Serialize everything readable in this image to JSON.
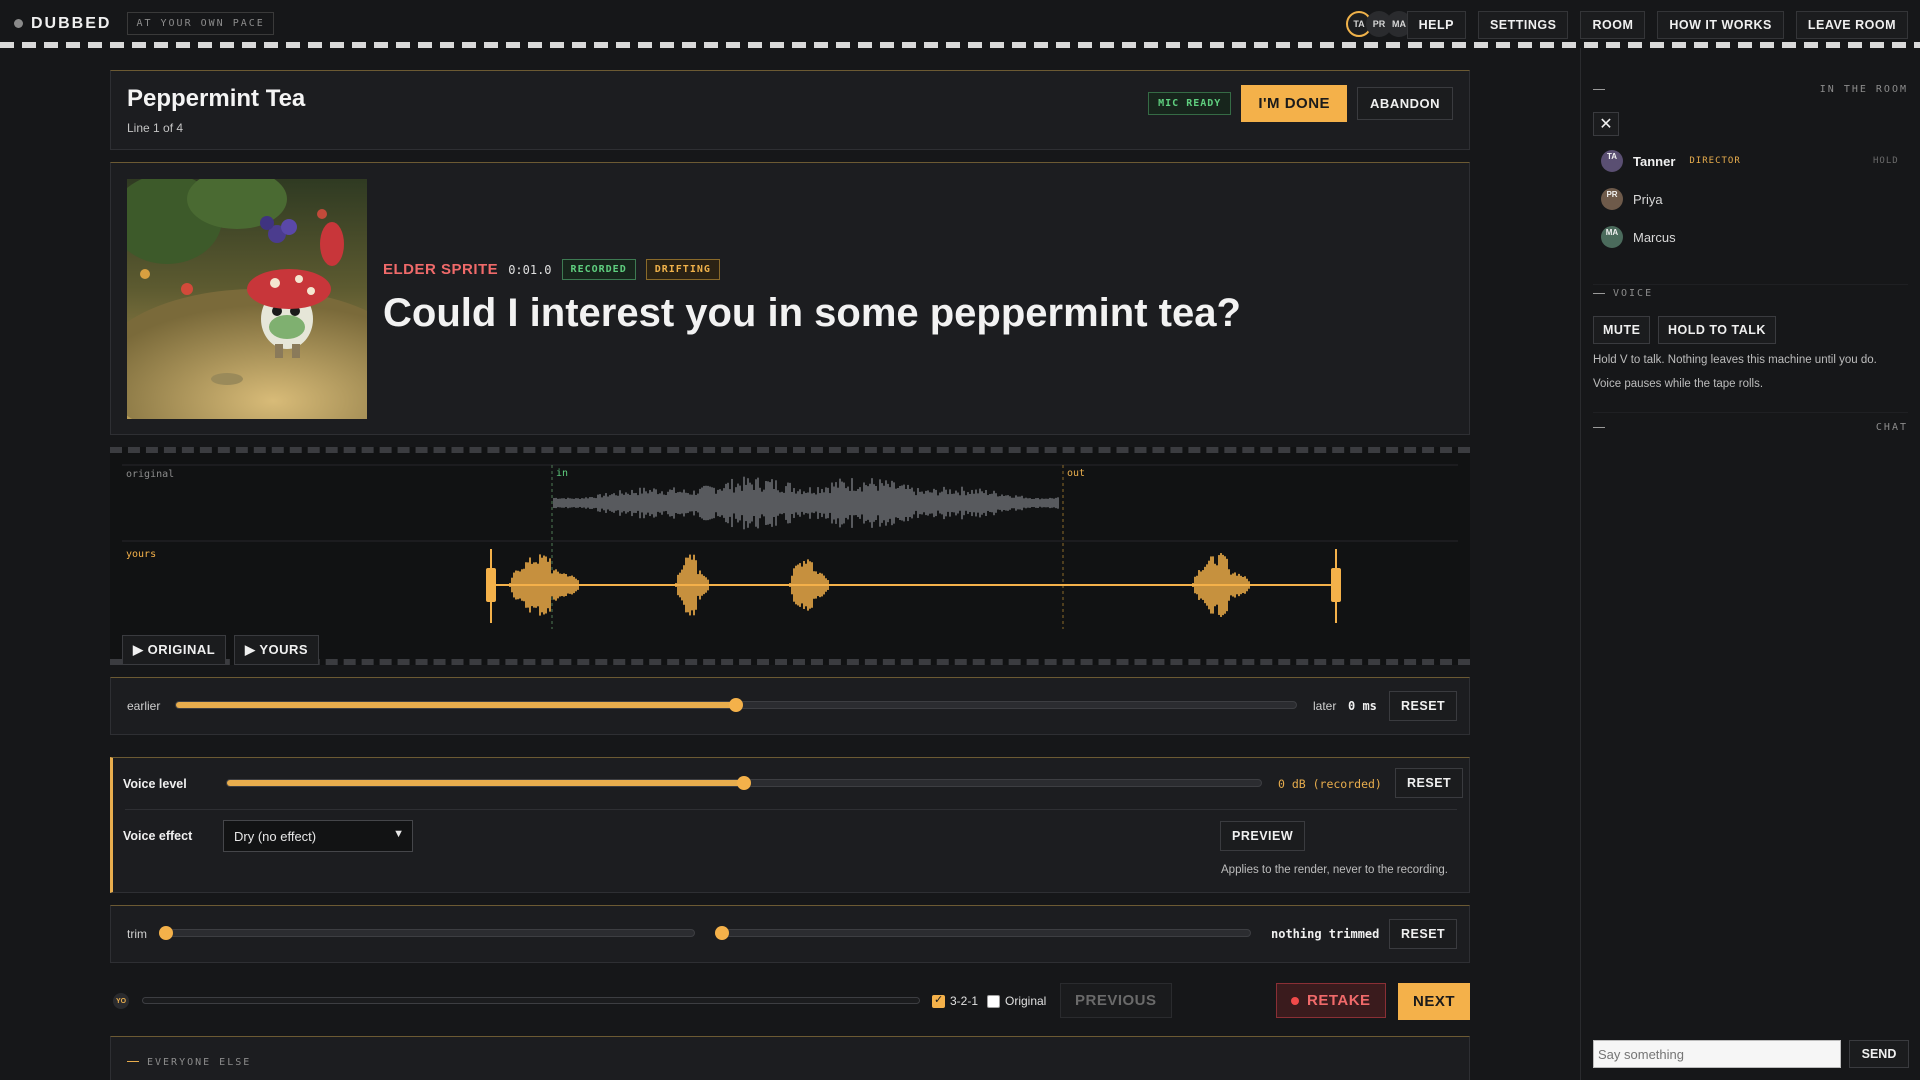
{
  "topbar": {
    "brand": "DUBBED",
    "mode_badge": "AT YOUR OWN PACE",
    "presence": [
      "TA",
      "PR",
      "MA"
    ],
    "nav": [
      "HELP",
      "SETTINGS",
      "ROOM",
      "HOW IT WORKS",
      "LEAVE ROOM"
    ]
  },
  "header": {
    "title": "Peppermint Tea",
    "subtitle": "Line 1 of 4",
    "mic_status": "MIC READY",
    "done_label": "I'M DONE",
    "abandon_label": "ABANDON"
  },
  "line": {
    "character": "ELDER SPRITE",
    "timecode": "0:01.0",
    "tags": [
      "RECORDED",
      "DRIFTING"
    ],
    "text": "Could I interest you in some peppermint tea?"
  },
  "waveform": {
    "original_label": "original",
    "yours_label": "yours",
    "in_marker": "in",
    "out_marker": "out",
    "play_original": "▶ ORIGINAL",
    "play_yours": "▶ YOURS"
  },
  "nudge": {
    "earlier_label": "earlier",
    "later_label": "later",
    "value": "0 ms",
    "position": 0.5,
    "reset_label": "RESET"
  },
  "voice": {
    "level_label": "Voice level",
    "level_value": "0 dB (recorded)",
    "level_position": 0.5,
    "level_reset": "RESET",
    "effect_label": "Voice effect",
    "effect_selected": "Dry (no effect)",
    "preview_label": "PREVIEW",
    "note": "Applies to the render, never to the recording."
  },
  "trim": {
    "label": "trim",
    "status": "nothing trimmed",
    "reset_label": "RESET",
    "start": 0.0,
    "end": 0.0
  },
  "footer": {
    "avatar": "YO",
    "countdown_label": "3-2-1",
    "countdown_checked": true,
    "original_label": "Original",
    "original_checked": false,
    "previous_label": "PREVIOUS",
    "retake_label": "RETAKE",
    "next_label": "NEXT"
  },
  "everyone": {
    "label": "EVERYONE ELSE"
  },
  "side": {
    "room_label": "IN THE ROOM",
    "members": [
      {
        "initials": "TA",
        "name": "Tanner",
        "role": "DIRECTOR",
        "status": "HOLD",
        "color": "#5a4f72"
      },
      {
        "initials": "PR",
        "name": "Priya",
        "role": "",
        "status": "",
        "color": "#6e5a4a"
      },
      {
        "initials": "MA",
        "name": "Marcus",
        "role": "",
        "status": "",
        "color": "#4b6b5c"
      }
    ],
    "voice_label": "VOICE",
    "mute_label": "MUTE",
    "hold_label": "HOLD TO TALK",
    "voice_hint_1": "Hold V to talk. Nothing leaves this machine until you do.",
    "voice_hint_2": "Voice pauses while the tape rolls.",
    "chat_label": "CHAT",
    "chat_placeholder": "Say something",
    "send_label": "SEND"
  },
  "colors": {
    "accent": "#f4b14a",
    "danger": "#f06a6a",
    "success": "#5fcf7f",
    "background": "#161719"
  }
}
